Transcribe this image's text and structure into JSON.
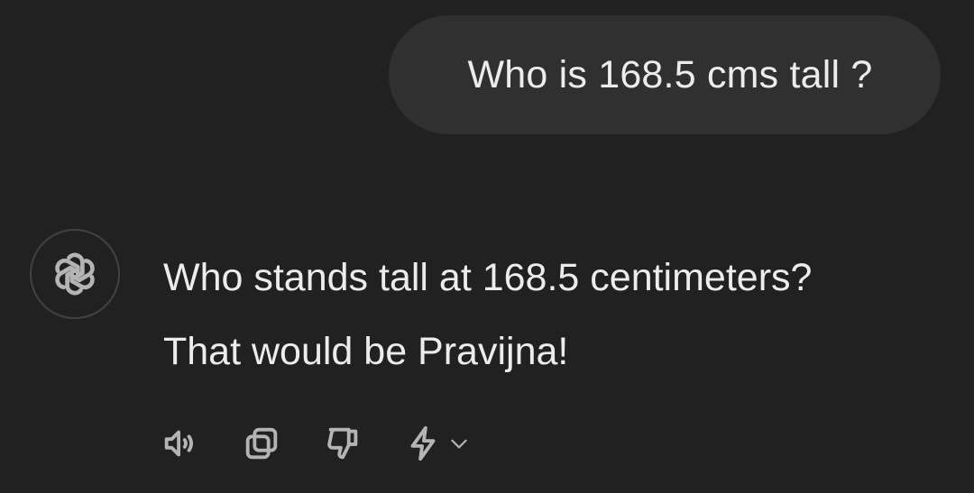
{
  "conversation": {
    "user_message": "Who is 168.5 cms tall ?",
    "assistant_message": {
      "lines": [
        "Who stands tall at 168.5 centimeters?",
        "That would be Pravijna!"
      ]
    }
  },
  "avatar": {
    "icon": "openai-logo-icon"
  },
  "actions": [
    {
      "id": "read-aloud",
      "icon": "speaker-icon"
    },
    {
      "id": "copy",
      "icon": "copy-icon"
    },
    {
      "id": "bad-response",
      "icon": "thumbs-down-icon"
    },
    {
      "id": "regenerate",
      "icon": "lightning-icon"
    }
  ],
  "colors": {
    "background": "#212121",
    "user_bubble": "#303030",
    "text": "#ececec",
    "icon": "#b4b4b4"
  }
}
